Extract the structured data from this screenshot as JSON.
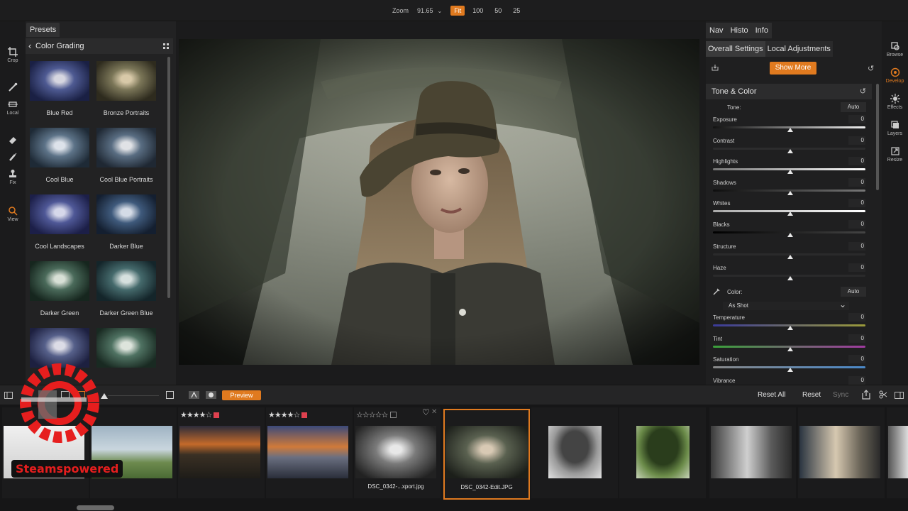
{
  "colors": {
    "accent": "#e07a1f",
    "flag_red": "#e0414f"
  },
  "zoom": {
    "label": "Zoom",
    "value": "91.65",
    "options": [
      "Fit",
      "100",
      "50",
      "25"
    ],
    "active": "Fit"
  },
  "tool_rail": [
    {
      "icon": "crop-icon",
      "label": "Crop"
    },
    {
      "icon": "brush-icon",
      "label": ""
    },
    {
      "icon": "local-icon",
      "label": "Local"
    },
    {
      "icon": "eraser-icon",
      "label": ""
    },
    {
      "icon": "retouch-brush-icon",
      "label": ""
    },
    {
      "icon": "stamp-icon",
      "label": "Fix"
    },
    {
      "icon": "magnify-icon",
      "label": "View"
    }
  ],
  "presets": {
    "tab": "Presets",
    "category": "Color Grading",
    "items": [
      {
        "label": "Blue Red"
      },
      {
        "label": "Bronze Portraits"
      },
      {
        "label": "Cool Blue"
      },
      {
        "label": "Cool Blue Portraits"
      },
      {
        "label": "Cool Landscapes"
      },
      {
        "label": "Darker Blue"
      },
      {
        "label": "Darker Green"
      },
      {
        "label": "Darker Green Blue"
      },
      {
        "label": ""
      },
      {
        "label": ""
      }
    ]
  },
  "right_panel": {
    "tabs": [
      "Nav",
      "Histo",
      "Info"
    ],
    "subtabs": [
      "Overall Settings",
      "Local Adjustments"
    ],
    "show_more": "Show More",
    "section": "Tone & Color",
    "tone_label": "Tone:",
    "tone_auto": "Auto",
    "color_label": "Color:",
    "color_auto": "Auto",
    "white_balance": "As Shot",
    "adjustments": [
      {
        "name": "Exposure",
        "value": "0"
      },
      {
        "name": "Contrast",
        "value": "0"
      },
      {
        "name": "Highlights",
        "value": "0"
      },
      {
        "name": "Shadows",
        "value": "0"
      },
      {
        "name": "Whites",
        "value": "0"
      },
      {
        "name": "Blacks",
        "value": "0"
      },
      {
        "name": "Structure",
        "value": "0"
      },
      {
        "name": "Haze",
        "value": "0"
      },
      {
        "name": "Temperature",
        "value": "0"
      },
      {
        "name": "Tint",
        "value": "0"
      },
      {
        "name": "Saturation",
        "value": "0"
      },
      {
        "name": "Vibrance",
        "value": "0"
      }
    ]
  },
  "icon_rail": [
    {
      "icon": "browse-icon",
      "label": "Browse",
      "active": false
    },
    {
      "icon": "develop-icon",
      "label": "Develop",
      "active": true
    },
    {
      "icon": "effects-icon",
      "label": "Effects",
      "active": false
    },
    {
      "icon": "layers-icon",
      "label": "Layers",
      "active": false
    },
    {
      "icon": "resize-icon",
      "label": "Resize",
      "active": false
    }
  ],
  "strip_toolbar": {
    "preview": "Preview",
    "reset_all": "Reset All",
    "reset": "Reset",
    "sync": "Sync"
  },
  "filmstrip": [
    {
      "stars": "",
      "file": ""
    },
    {
      "stars": "",
      "file": ""
    },
    {
      "stars": "★★★★☆",
      "flag": true,
      "file": ""
    },
    {
      "stars": "★★★★☆",
      "flag": true,
      "file": ""
    },
    {
      "stars": "☆☆☆☆☆",
      "flag": false,
      "file": "DSC_0342-...xport.jpg"
    },
    {
      "stars": "",
      "file": "DSC_0342-Edit.JPG",
      "selected": true
    },
    {
      "stars": "",
      "file": ""
    },
    {
      "stars": "",
      "file": ""
    },
    {
      "stars": "",
      "file": ""
    },
    {
      "stars": "",
      "file": ""
    }
  ],
  "watermark": "Steamspowered"
}
